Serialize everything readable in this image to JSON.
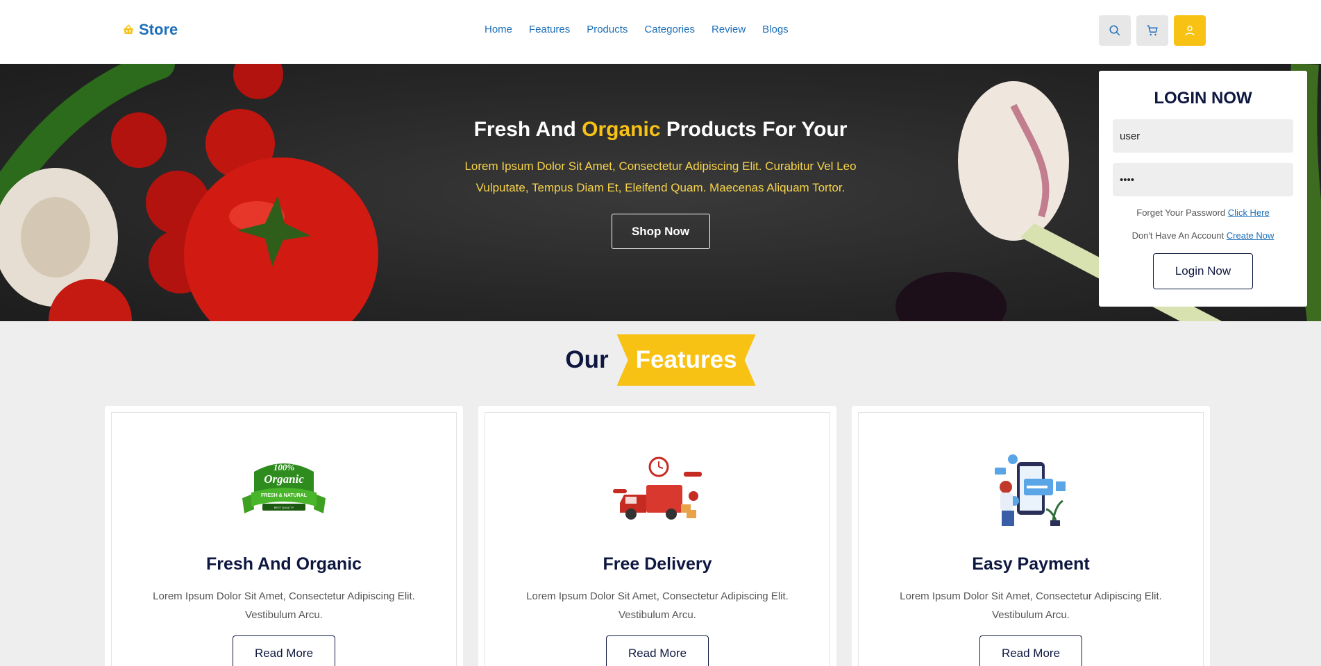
{
  "header": {
    "logo_text": "Store",
    "nav": [
      "Home",
      "Features",
      "Products",
      "Categories",
      "Review",
      "Blogs"
    ]
  },
  "hero": {
    "title_before": "Fresh And ",
    "title_highlight": "Organic",
    "title_after": " Products For Your",
    "text": "Lorem Ipsum Dolor Sit Amet, Consectetur Adipiscing Elit. Curabitur Vel Leo Vulputate, Tempus Diam Et, Eleifend Quam. Maecenas Aliquam Tortor.",
    "button": "Shop Now"
  },
  "login": {
    "title": "LOGIN NOW",
    "username_value": "user",
    "password_value": "••••",
    "forgot_text": "Forget Your Password ",
    "forgot_link": "Click Here",
    "account_text": "Don't Have An Account ",
    "account_link": "Create Now",
    "button": "Login Now"
  },
  "features": {
    "heading_plain": "Our",
    "heading_tag": "Features",
    "cards": [
      {
        "title": "Fresh And Organic",
        "text": "Lorem Ipsum Dolor Sit Amet, Consectetur Adipiscing Elit. Vestibulum Arcu.",
        "button": "Read More",
        "badge_line1": "100%",
        "badge_line2": "Organic",
        "badge_line3": "FRESH & NATURAL",
        "badge_line4": "BEST QUALITY"
      },
      {
        "title": "Free Delivery",
        "text": "Lorem Ipsum Dolor Sit Amet, Consectetur Adipiscing Elit. Vestibulum Arcu.",
        "button": "Read More"
      },
      {
        "title": "Easy Payment",
        "text": "Lorem Ipsum Dolor Sit Amet, Consectetur Adipiscing Elit. Vestibulum Arcu.",
        "button": "Read More"
      }
    ]
  },
  "colors": {
    "accent": "#f7c213",
    "brand": "#1d6fb8",
    "navy": "#0e1740"
  }
}
